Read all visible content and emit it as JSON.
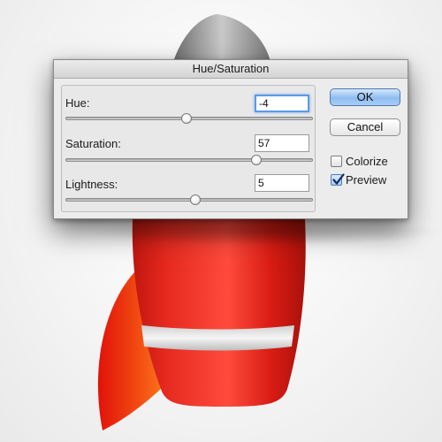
{
  "dialog": {
    "title": "Hue/Saturation",
    "hue": {
      "label": "Hue:",
      "value": "-4",
      "slider_fraction": 0.49
    },
    "saturation": {
      "label": "Saturation:",
      "value": "57",
      "slider_fraction": 0.77
    },
    "lightness": {
      "label": "Lightness:",
      "value": "5",
      "slider_fraction": 0.525
    },
    "buttons": {
      "ok": "OK",
      "cancel": "Cancel"
    },
    "colorize": {
      "label": "Colorize",
      "checked": false
    },
    "preview": {
      "label": "Preview",
      "checked": true
    }
  },
  "colors": {
    "rocket_red": "#e2231a",
    "rocket_dark_red": "#b71510",
    "fin_orange": "#f07a10",
    "nose_gray": "#8c8c8c",
    "stripe": "#e6e6e6",
    "accent_blue": "#5b9ae8"
  }
}
